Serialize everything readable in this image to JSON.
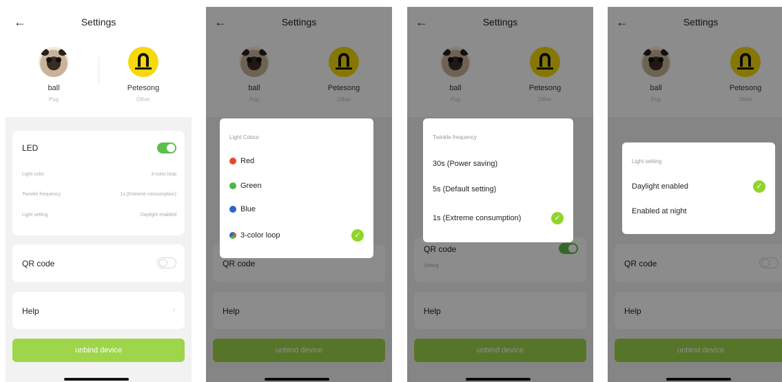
{
  "header": {
    "title": "Settings",
    "back_icon": "back-arrow-icon"
  },
  "pets": [
    {
      "name": "ball",
      "subtitle": "Pug"
    },
    {
      "name": "Petesong",
      "subtitle": "Other"
    }
  ],
  "led": {
    "label": "LED",
    "rows": [
      {
        "label": "Light color",
        "value": "3-color loop"
      },
      {
        "label": "Twinkle frequency",
        "value": "1s (Extreme consumption)"
      },
      {
        "label": "Light setting",
        "value": "Daylight enabled"
      }
    ]
  },
  "qr": {
    "label": "QR code",
    "setting_label": "Setting"
  },
  "help": {
    "label": "Help"
  },
  "unbind": {
    "label": "unbind device"
  },
  "color_modal": {
    "title": "Light Colour",
    "options": [
      {
        "label": "Red",
        "color": "#e94a2a"
      },
      {
        "label": "Green",
        "color": "#4cb648"
      },
      {
        "label": "Blue",
        "color": "#2f63c9"
      },
      {
        "label": "3-color loop",
        "color": "multi"
      }
    ],
    "selected_index": 3
  },
  "twinkle_modal": {
    "title": "Twinkle frequency",
    "options": [
      "30s (Power saving)",
      "5s (Default setting)",
      "1s (Extreme consumption)"
    ],
    "selected_index": 2
  },
  "light_modal": {
    "title": "Light setting",
    "options": [
      "Daylight enabled",
      "Enabled at night"
    ],
    "selected_index": 0
  },
  "colors": {
    "accent_green": "#8fd52a",
    "toggle_green": "#5cbf4a",
    "unbind_green": "#9fd54a"
  }
}
